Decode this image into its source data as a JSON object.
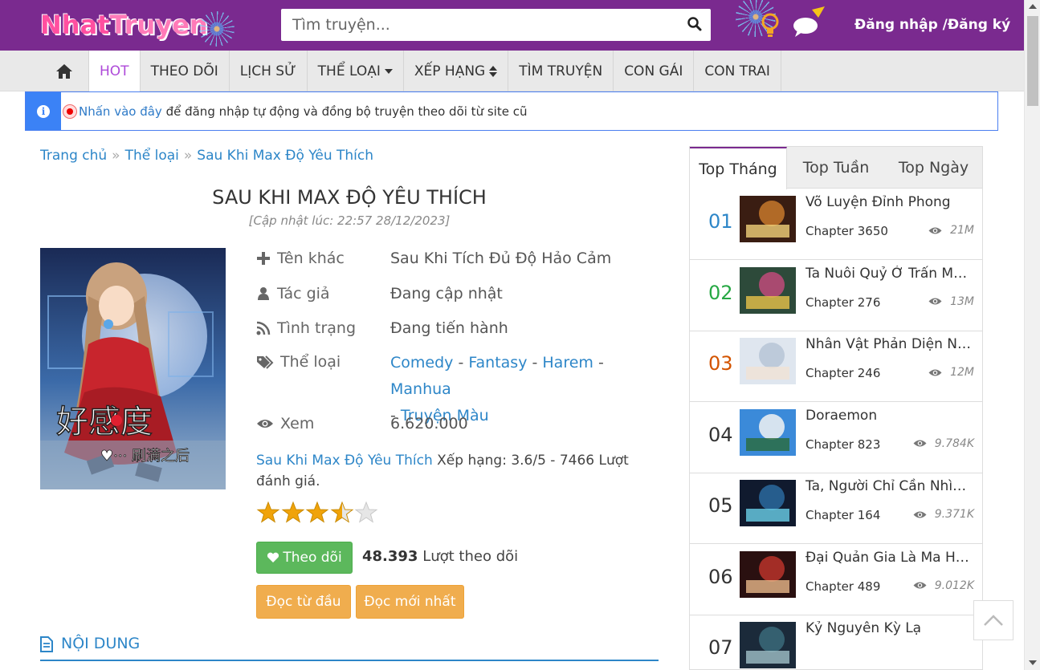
{
  "header": {
    "logo_part1": "Nhat",
    "logo_part2": "Truyen",
    "search_placeholder": "Tìm truyện...",
    "login_text": "Đăng nhập /Đăng ký"
  },
  "nav": {
    "items": [
      {
        "label": "HOT",
        "active": true
      },
      {
        "label": "THEO DÕI"
      },
      {
        "label": "LỊCH SỬ"
      },
      {
        "label": "THỂ LOẠI"
      },
      {
        "label": "XẾP HẠNG"
      },
      {
        "label": "TÌM TRUYỆN"
      },
      {
        "label": "CON GÁI"
      },
      {
        "label": "CON TRAI"
      }
    ]
  },
  "alert": {
    "link_text": "Nhấn vào đây",
    "rest_text": " để đăng nhập tự động và đồng bộ truyện theo dõi từ site cũ"
  },
  "breadcrumb": [
    "Trang chủ",
    "Thể loại",
    "Sau Khi Max Độ Yêu Thích"
  ],
  "comic": {
    "title": "SAU KHI MAX ĐỘ YÊU THÍCH",
    "updated": "[Cập nhật lúc: 22:57 28/12/2023]",
    "other_name_label": "Tên khác",
    "other_name": "Sau Khi Tích Đủ Độ Hảo Cảm",
    "author_label": "Tác giả",
    "author": "Đang cập nhật",
    "status_label": "Tình trạng",
    "status": "Đang tiến hành",
    "genre_label": "Thể loại",
    "genres": [
      "Comedy",
      "Fantasy",
      "Harem",
      "Manhua",
      "Truyện Màu"
    ],
    "views_label": "Xem",
    "views": "6.620.000",
    "rating_link": "Sau Khi Max Độ Yêu Thích",
    "rating_text": " Xếp hạng: 3.6/5 - 7466 Lượt đánh giá.",
    "rating_value": 3.6,
    "rating_max": 5,
    "follow_label": "Theo dõi",
    "follow_count": "48.393",
    "follow_suffix": " Lượt theo dõi",
    "read_first": "Đọc từ đầu",
    "read_latest": "Đọc mới nhất",
    "section_title": "NỘI DUNG"
  },
  "sidebar": {
    "tabs": [
      "Top Tháng",
      "Top Tuần",
      "Top Ngày"
    ],
    "items": [
      {
        "rank": "01",
        "name": "Võ Luyện Đỉnh Phong",
        "chapter": "Chapter 3650",
        "views": "21M",
        "rank_color": "#2d86c8"
      },
      {
        "rank": "02",
        "name": "Ta Nuôi Quỷ Ở Trấn Ma Ty",
        "chapter": "Chapter 276",
        "views": "13M",
        "rank_color": "#27a844"
      },
      {
        "rank": "03",
        "name": "Nhân Vật Phản Diện Này Có Chút Lương Tâm",
        "chapter": "Chapter 246",
        "views": "12M",
        "rank_color": "#d35400"
      },
      {
        "rank": "04",
        "name": "Doraemon",
        "chapter": "Chapter 823",
        "views": "9.784K",
        "rank_color": "#333333"
      },
      {
        "rank": "05",
        "name": "Ta, Người Chỉ Cần Nhìn Thấy Thanh Máu",
        "chapter": "Chapter 164",
        "views": "9.371K",
        "rank_color": "#333333"
      },
      {
        "rank": "06",
        "name": "Đại Quản Gia Là Ma Hoàng",
        "chapter": "Chapter 489",
        "views": "9.012K",
        "rank_color": "#333333"
      },
      {
        "rank": "07",
        "name": "Kỷ Nguyên Kỳ Lạ",
        "chapter": "",
        "views": "",
        "rank_color": "#333333"
      }
    ]
  },
  "colors": {
    "header_bg": "#7a2a8f",
    "nav_active": "#ae4ad9",
    "link": "#2d86c8",
    "follow_btn": "#5cb85c",
    "read_btn": "#f0ad4e",
    "star": "#f0a30a"
  }
}
